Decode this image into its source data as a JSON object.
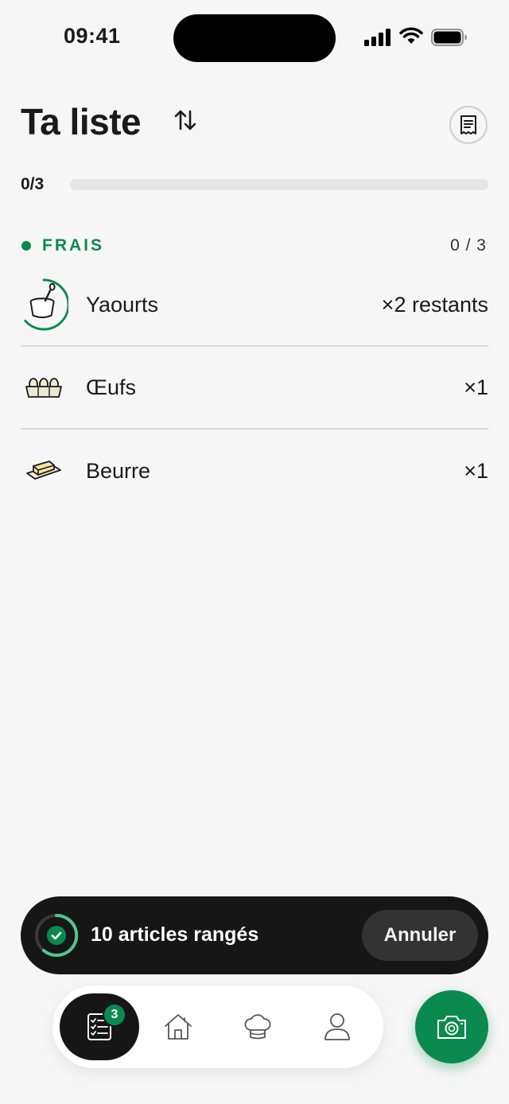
{
  "status_bar": {
    "time": "09:41"
  },
  "header": {
    "title": "Ta liste"
  },
  "progress": {
    "label": "0/3",
    "fraction": 0.0
  },
  "section": {
    "title": "FRAIS",
    "count": "0 / 3",
    "items": [
      {
        "name": "Yaourts",
        "qty": "×2 restants",
        "icon": "yogurt-icon"
      },
      {
        "name": "Œufs",
        "qty": "×1",
        "icon": "egg-carton-icon"
      },
      {
        "name": "Beurre",
        "qty": "×1",
        "icon": "butter-icon"
      }
    ]
  },
  "toast": {
    "text": "10 articles rangés",
    "undo_label": "Annuler"
  },
  "nav": {
    "badge_count": "3"
  },
  "colors": {
    "accent": "#0b8a4f",
    "toast_bg": "#161616",
    "background": "#f6f6f6"
  }
}
